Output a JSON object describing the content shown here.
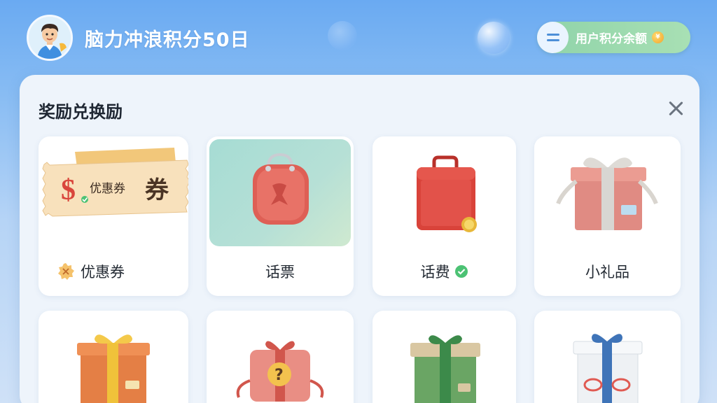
{
  "header": {
    "title": "脑力冲浪积分50日"
  },
  "points_button": {
    "label": "用户积分余额"
  },
  "panel": {
    "title": "奖励兑换励",
    "cards": [
      {
        "label": "优惠券",
        "ticket_text": "优惠券",
        "ticket_big": "券"
      },
      {
        "label": "话票"
      },
      {
        "label": "话费"
      },
      {
        "label": "小礼品"
      },
      {
        "label": ""
      },
      {
        "label": ""
      },
      {
        "label": ""
      },
      {
        "label": ""
      }
    ]
  },
  "colors": {
    "sky": "#6aaaf2",
    "pill": "#a8e0b4",
    "panel": "#eef4fb",
    "accent_check": "#4cc274"
  }
}
